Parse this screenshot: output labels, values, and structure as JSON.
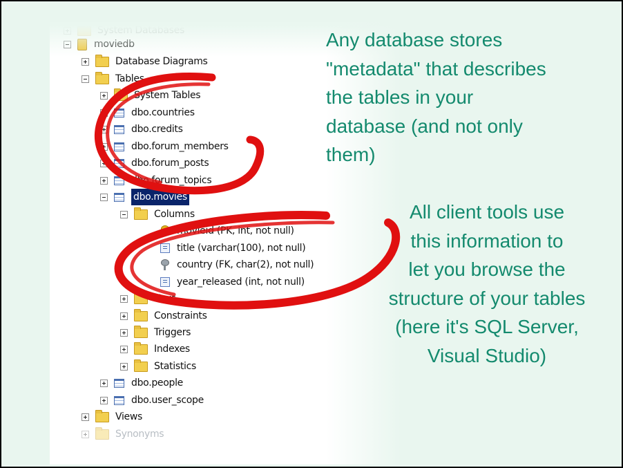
{
  "slide": {
    "callout_top": "Any database stores\n\"metadata\" that describes\nthe tables in your\ndatabase (and not only\nthem)",
    "callout_bottom": "All client tools use\nthis information to\nlet you browse the\nstructure of your tables\n(here it's SQL Server,\nVisual Studio)",
    "text_color": "#148a6e",
    "annotation_color": "#e01010"
  },
  "tree": {
    "system_databases": "System Databases",
    "db_name": "moviedb",
    "database_diagrams": "Database Diagrams",
    "tables": "Tables",
    "system_tables": "System Tables",
    "t_countries": "dbo.countries",
    "t_credits": "dbo.credits",
    "t_forum_members": "dbo.forum_members",
    "t_forum_posts": "dbo.forum_posts",
    "t_forum_topics": "dbo.forum_topics",
    "t_movies": "dbo.movies",
    "columns": "Columns",
    "col_movieid": "movieid (PK, int, not null)",
    "col_title": "title (varchar(100), not null)",
    "col_country": "country (FK, char(2), not null)",
    "col_year_released": "year_released (int, not null)",
    "keys": "Keys",
    "constraints": "Constraints",
    "triggers": "Triggers",
    "indexes": "Indexes",
    "statistics": "Statistics",
    "t_people": "dbo.people",
    "t_user_scope": "dbo.user_scope",
    "views": "Views",
    "synonyms": "Synonyms"
  }
}
